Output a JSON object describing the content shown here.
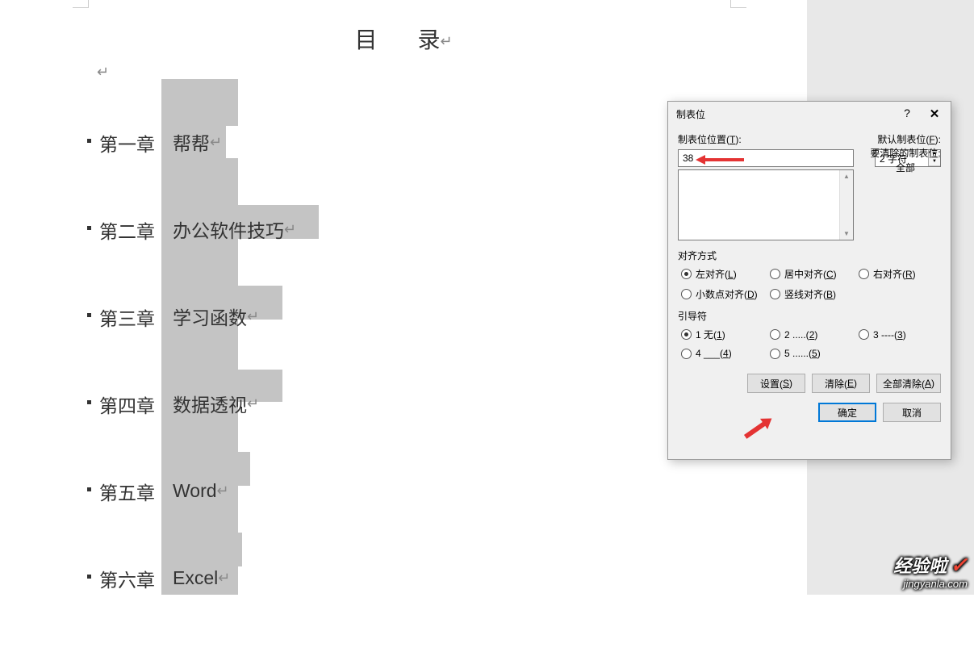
{
  "doc": {
    "title_char1": "目",
    "title_char2": "录",
    "return_mark": "↵",
    "items": [
      {
        "num": "第一章",
        "title": "帮帮"
      },
      {
        "num": "第二章",
        "title": "办公软件技巧"
      },
      {
        "num": "第三章",
        "title": "学习函数"
      },
      {
        "num": "第四章",
        "title": "数据透视"
      },
      {
        "num": "第五章",
        "title": "Word"
      },
      {
        "num": "第六章",
        "title": "Excel"
      }
    ]
  },
  "dialog": {
    "title": "制表位",
    "help": "?",
    "close": "✕",
    "tab_pos_label": "制表位位置(T):",
    "tab_pos_value": "38",
    "default_label": "默认制表位(F):",
    "default_value": "2 字符",
    "clear_label1": "要清除的制表位:",
    "clear_label2": "全部",
    "align_label": "对齐方式",
    "align_options": [
      {
        "label": "左对齐(L)",
        "selected": true
      },
      {
        "label": "居中对齐(C)",
        "selected": false
      },
      {
        "label": "右对齐(R)",
        "selected": false
      },
      {
        "label": "小数点对齐(D)",
        "selected": false
      },
      {
        "label": "竖线对齐(B)",
        "selected": false
      }
    ],
    "leader_label": "引导符",
    "leader_options": [
      {
        "label": "1 无(1)",
        "selected": true
      },
      {
        "label": "2 .....(2)",
        "selected": false
      },
      {
        "label": "3 ----(3)",
        "selected": false
      },
      {
        "label": "4 ___(4)",
        "selected": false
      },
      {
        "label": "5 ......(5)",
        "selected": false
      }
    ],
    "btn_set": "设置(S)",
    "btn_clear": "清除(E)",
    "btn_clear_all": "全部清除(A)",
    "btn_ok": "确定",
    "btn_cancel": "取消"
  },
  "watermark": {
    "text1": "经验啦",
    "text2": "jingyanla.com"
  }
}
